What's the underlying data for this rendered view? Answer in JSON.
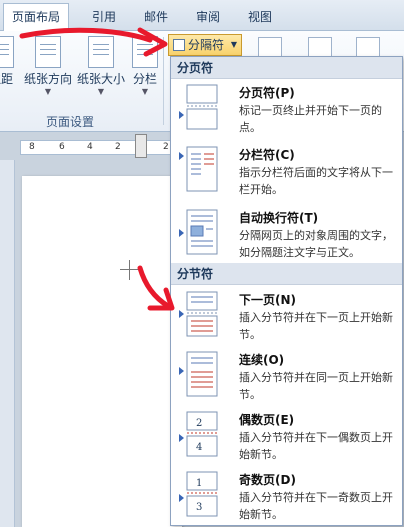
{
  "tabs": [
    {
      "label": "页面布局",
      "active": true
    },
    {
      "label": "引用"
    },
    {
      "label": "邮件"
    },
    {
      "label": "审阅"
    },
    {
      "label": "视图"
    }
  ],
  "ribbon": {
    "margin_label": "边距",
    "orientation_label": "纸张方向",
    "size_label": "纸张大小",
    "columns_label": "分栏",
    "breaks_label": "分隔符",
    "group_label": "页面设置"
  },
  "ruler": {
    "ticks": [
      "8",
      "6",
      "4",
      "2",
      "2"
    ]
  },
  "menu": {
    "page_breaks_header": "分页符",
    "section_breaks_header": "分节符",
    "items": [
      {
        "title": "分页符(P)",
        "desc": "标记一页终止并开始下一页的点。"
      },
      {
        "title": "分栏符(C)",
        "desc": "指示分栏符后面的文字将从下一栏开始。"
      },
      {
        "title": "自动换行符(T)",
        "desc": "分隔网页上的对象周围的文字，如分隔题注文字与正文。"
      },
      {
        "title": "下一页(N)",
        "desc": "插入分节符并在下一页上开始新节。"
      },
      {
        "title": "连续(O)",
        "desc": "插入分节符并在同一页上开始新节。"
      },
      {
        "title": "偶数页(E)",
        "desc": "插入分节符并在下一偶数页上开始新节。"
      },
      {
        "title": "奇数页(D)",
        "desc": "插入分节符并在下一奇数页上开始新节。"
      }
    ],
    "even_page_numbers": [
      "2",
      "4"
    ],
    "odd_page_numbers": [
      "1",
      "3"
    ]
  },
  "colors": {
    "annotation": "#e8192c",
    "accent": "#3a66b5"
  }
}
